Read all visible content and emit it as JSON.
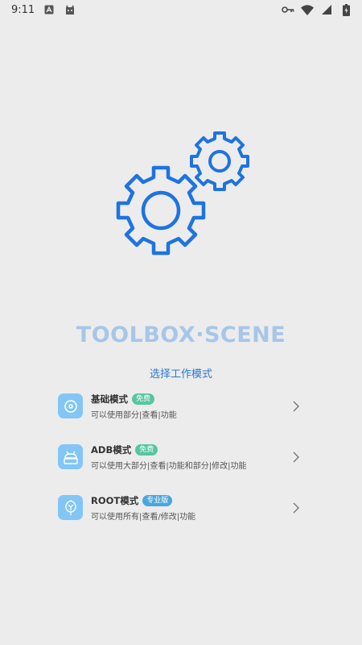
{
  "status_bar": {
    "time": "9:11",
    "icons": [
      "notification-a-icon",
      "android-cat-icon",
      "vpn-key-icon",
      "wifi-icon",
      "signal-icon",
      "battery-icon"
    ]
  },
  "app": {
    "title": "TOOLBOX·SCENE",
    "subtitle": "选择工作模式",
    "accent_color": "#2e77d0",
    "gear_color": "#1e73e0"
  },
  "modes": [
    {
      "title": "基础模式",
      "badge": "免费",
      "desc": "可以使用部分|查看|功能",
      "icon": "disc-icon"
    },
    {
      "title": "ADB模式",
      "badge": "免费",
      "desc": "可以使用大部分|查看|功能和部分|修改|功能",
      "icon": "android-icon"
    },
    {
      "title": "ROOT模式",
      "badge": "专业版",
      "desc": "可以使用所有|查看/修改|功能",
      "icon": "root-icon"
    }
  ]
}
